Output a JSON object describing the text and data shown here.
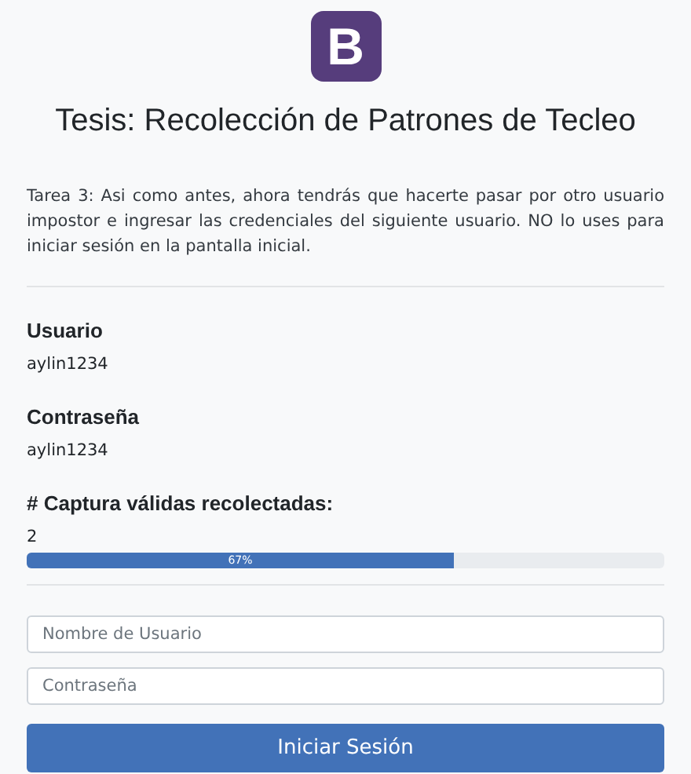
{
  "logo": {
    "letter": "B"
  },
  "title": "Tesis: Recolección de Patrones de Tecleo",
  "instructions": "Tarea 3: Asi como antes, ahora tendrás que hacerte pasar por otro usuario impostor e ingresar las credenciales del siguiente usuario. NO lo uses para iniciar sesión en la pantalla inicial.",
  "fields_info": [
    {
      "label": "Usuario",
      "value": "aylin1234"
    },
    {
      "label": "Contraseña",
      "value": "aylin1234"
    }
  ],
  "captures": {
    "label": "# Captura válidas recolectadas:",
    "count": "2",
    "level": 0.67,
    "reading": "67%"
  },
  "form": {
    "username": {
      "placeholder": "Nombre de Usuario"
    },
    "password": {
      "placeholder": "Contraseña"
    },
    "submit": "Iniciar Sesión"
  }
}
